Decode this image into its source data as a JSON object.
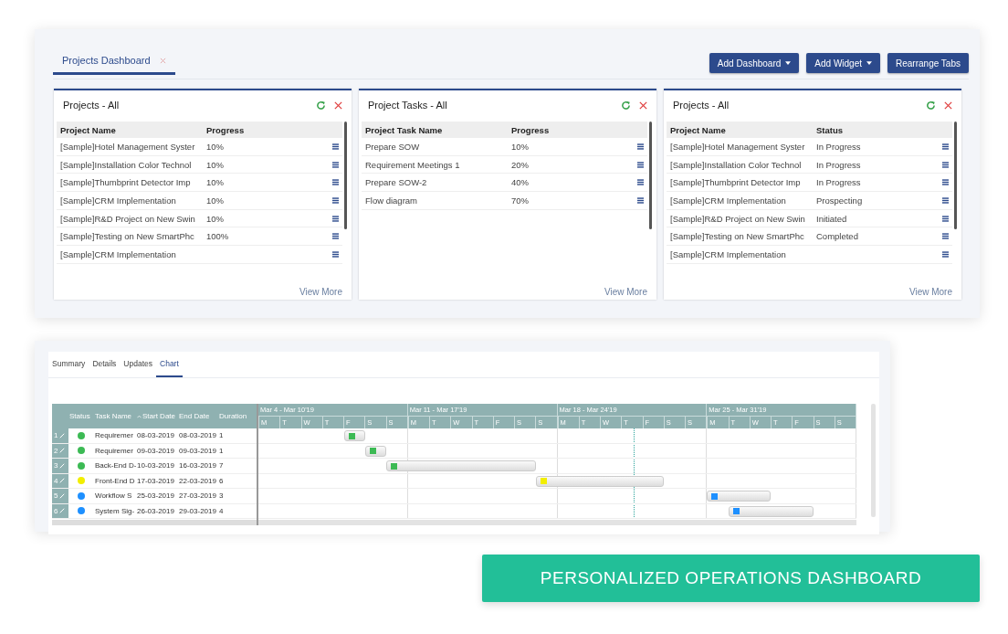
{
  "tabs": [
    {
      "label": "Projects Dashboard",
      "selected": true
    }
  ],
  "buttons": [
    {
      "label": "Add Dashboard",
      "dropdown": true
    },
    {
      "label": "Add Widget",
      "dropdown": true
    },
    {
      "label": "Rearrange Tabs",
      "dropdown": false
    }
  ],
  "widgets": [
    {
      "title": "Projects - All",
      "columns": [
        "Project Name",
        "Progress"
      ],
      "rows": [
        {
          "name": "[Sample]Hotel Management Syster",
          "value": "10%"
        },
        {
          "name": "[Sample]Installation Color Technol",
          "value": "10%"
        },
        {
          "name": "[Sample]Thumbprint Detector Imp",
          "value": "10%"
        },
        {
          "name": "[Sample]CRM Implementation",
          "value": "10%"
        },
        {
          "name": "[Sample]R&D Project on New Swin",
          "value": "10%"
        },
        {
          "name": "[Sample]Testing on New SmartPhc",
          "value": "100%"
        },
        {
          "name": "[Sample]CRM Implementation"
        }
      ],
      "link": "View More"
    },
    {
      "title": "Project Tasks - All",
      "columns": [
        "Project Task Name",
        "Progress"
      ],
      "rows": [
        {
          "name": "Prepare SOW",
          "value": "10%"
        },
        {
          "name": "Requirement Meetings 1",
          "value": "20%"
        },
        {
          "name": "Prepare SOW-2",
          "value": "40%"
        },
        {
          "name": "Flow diagram",
          "value": "70%"
        }
      ],
      "link": "View More"
    },
    {
      "title": "Projects - All",
      "columns": [
        "Project Name",
        "Status"
      ],
      "rows": [
        {
          "name": "[Sample]Hotel Management Syster",
          "value": "In Progress"
        },
        {
          "name": "[Sample]Installation Color Technol",
          "value": "In Progress"
        },
        {
          "name": "[Sample]Thumbprint Detector Imp",
          "value": "In Progress"
        },
        {
          "name": "[Sample]CRM Implementation",
          "value": "Prospecting"
        },
        {
          "name": "[Sample]R&D Project on New Swin",
          "value": "Initiated"
        },
        {
          "name": "[Sample]Testing on New SmartPhc",
          "value": "Completed"
        },
        {
          "name": "[Sample]CRM Implementation"
        }
      ],
      "link": "View More"
    }
  ],
  "detail_tabs": [
    {
      "label": "Summary",
      "selected": false
    },
    {
      "label": "Details",
      "selected": false
    },
    {
      "label": "Updates",
      "selected": false
    },
    {
      "label": "Chart",
      "selected": true
    }
  ],
  "gantt": {
    "columns": [
      "Status",
      "Task Name",
      "Start Date",
      "End Date",
      "Duration"
    ],
    "weeks": [
      {
        "label": "Mar 4 - Mar 10'19",
        "days": [
          "M",
          "T",
          "W",
          "T",
          "F",
          "S",
          "S"
        ]
      },
      {
        "label": "Mar 11 - Mar 17'19",
        "days": [
          "M",
          "T",
          "W",
          "T",
          "F",
          "S",
          "S"
        ]
      },
      {
        "label": "Mar 18 - Mar 24'19",
        "days": [
          "M",
          "T",
          "W",
          "T",
          "F",
          "S",
          "S"
        ]
      },
      {
        "label": "Mar 25 - Mar 31'19",
        "days": [
          "M",
          "T",
          "W",
          "T",
          "F",
          "S",
          "S"
        ]
      }
    ],
    "tasks": [
      {
        "number": "1",
        "color": "#3cba54",
        "name": "Requiremer",
        "start": "08-03-2019",
        "end": "08-03-2019",
        "duration": "1"
      },
      {
        "number": "2",
        "color": "#3cba54",
        "name": "Requiremer",
        "start": "09-03-2019",
        "end": "09-03-2019",
        "duration": "1"
      },
      {
        "number": "3",
        "color": "#3cba54",
        "name": "Back-End D-",
        "start": "10-03-2019",
        "end": "16-03-2019",
        "duration": "7"
      },
      {
        "number": "4",
        "color": "#f2ee00",
        "name": "Front-End D",
        "start": "17-03-2019",
        "end": "22-03-2019",
        "duration": "6"
      },
      {
        "number": "5",
        "color": "#1e90ff",
        "name": "Workflow S",
        "start": "25-03-2019",
        "end": "27-03-2019",
        "duration": "3"
      },
      {
        "number": "6",
        "color": "#1e90ff",
        "name": "System Sig-",
        "start": "26-03-2019",
        "end": "29-03-2019",
        "duration": "4"
      }
    ]
  },
  "banner": "PERSONALIZED OPERATIONS DASHBOARD"
}
